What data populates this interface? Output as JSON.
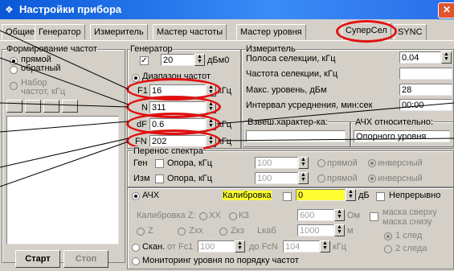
{
  "window": {
    "title": "Настройки прибора",
    "close": "✕",
    "icon": "❖"
  },
  "tabs": [
    "Общие",
    "Генератор",
    "Измеритель",
    "Мастер частоты",
    "Мастер уровня",
    "СуперСел",
    "SYNC"
  ],
  "freq_form": {
    "title": "Формирование частот",
    "direct": "прямой",
    "reverse": "обратный",
    "set_label": "Набор",
    "set_sub": "частот, кГц"
  },
  "generator": {
    "title": "Генератор",
    "level": "20",
    "unit": "дБм0",
    "range_title": "Диапазон частот",
    "f1_label": "F1",
    "f1": "16",
    "n_label": "N",
    "n": "311",
    "df_label": "dF",
    "df": "0.6",
    "fn_label": "FN",
    "fn": "202",
    "khz": "кГц"
  },
  "meter": {
    "title": "Измеритель",
    "band_label": "Полоса селекции, кГц",
    "band": "0.04",
    "freq_label": "Частота селекции, кГц",
    "max_label": "Макс. уровень, дБм",
    "max": "28",
    "avg_label": "Интервал усреднения, мин:сек",
    "avg": "00:00",
    "weight_label": "Взвеш.характер-ка:",
    "afc_label": "АЧХ относительно:",
    "afc_value": "Опорного уровня"
  },
  "transfer": {
    "title": "Перенос спектра",
    "gen": "Ген",
    "meas": "Изм",
    "ref_label": "Опора, кГц",
    "gen_val": "100",
    "meas_val": "100",
    "direct": "прямой",
    "inverse": "инверсный"
  },
  "afc": {
    "label": "АЧХ",
    "calib_label": "Калибровка",
    "calib_val": "0",
    "db": "дБ",
    "continuous": "Непрерывно",
    "calibz_label": "Калибровка Z:",
    "xx": "ХХ",
    "kz": "КЗ",
    "calibz_val": "600",
    "ohm": "Ом",
    "z": "Z",
    "zxx": "Zхх",
    "zkz": "Zкз",
    "lkab": "Lкаб",
    "lkab_val": "1000",
    "m": "м",
    "mask_up": "маска сверху",
    "mask_down": "маска снизу",
    "one_trace": "1 след",
    "two_traces": "2 следа"
  },
  "scan": {
    "label": "Скан.",
    "from": "от Fc1",
    "from_val": "100",
    "to": "до FcN",
    "to_val": "104",
    "khz": "кГц",
    "monitor": "Мониторинг уровня по порядку частот"
  },
  "buttons": {
    "start": "Старт",
    "stop": "Стоп"
  },
  "colors": {
    "accent": "#e01010",
    "title_bar": "#0a58d8",
    "highlight": "#ffff33"
  }
}
